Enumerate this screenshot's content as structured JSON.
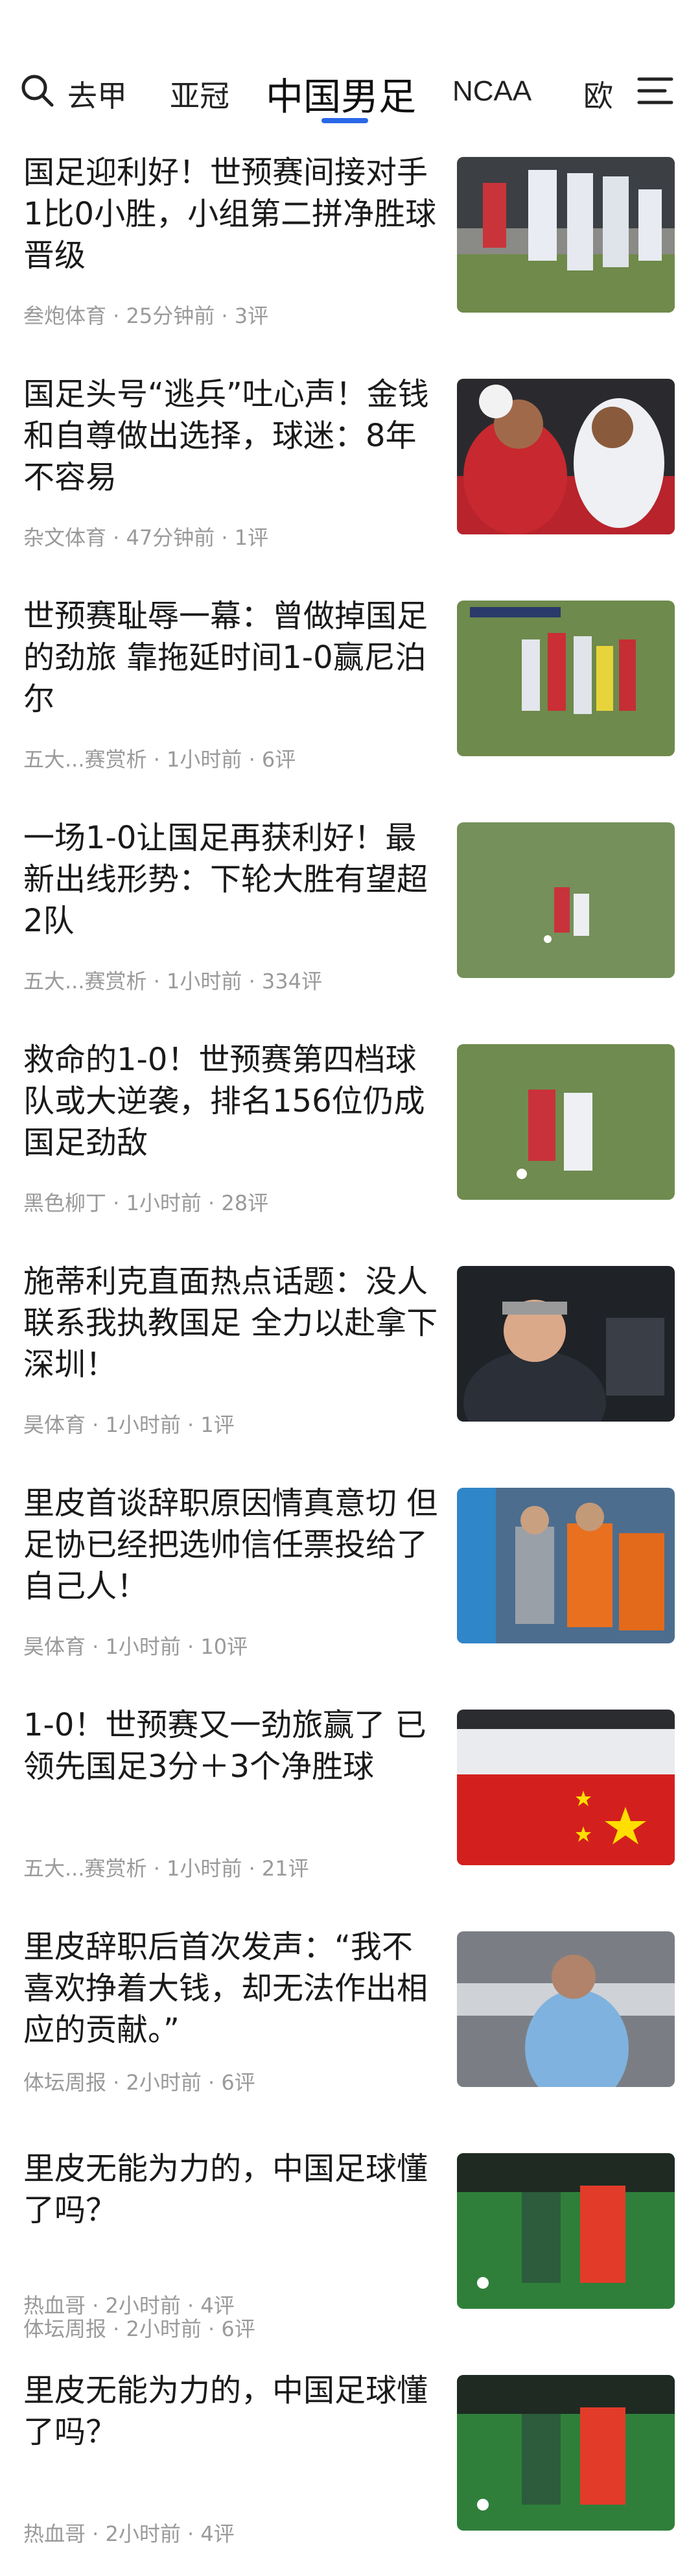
{
  "nav": {
    "tabs": [
      "去甲",
      "亚冠",
      "中国男足",
      "NCAA",
      "欧"
    ],
    "active_tab": "中国男足",
    "accent_color": "#2a67e8",
    "icons": [
      "search-icon",
      "menu-icon"
    ]
  },
  "feed": {
    "items": [
      {
        "title": "国足迎利好！世预赛间接对手1比0小胜，小组第二拼净胜球晋级",
        "meta": "叁炮体育 · 25分钟前 · 3评",
        "extra_meta": ""
      },
      {
        "title": "国足头号“逃兵”吐心声！金钱和自尊做出选择，球迷：8年不容易",
        "meta": "杂文体育 · 47分钟前 · 1评",
        "extra_meta": ""
      },
      {
        "title": "世预赛耻辱一幕：曾做掉国足的劲旅 靠拖延时间1-0赢尼泊尔",
        "meta": "五大...赛赏析 · 1小时前 · 6评",
        "extra_meta": ""
      },
      {
        "title": "一场1-0让国足再获利好！最新出线形势：下轮大胜有望超2队",
        "meta": "五大...赛赏析 · 1小时前 · 334评",
        "extra_meta": ""
      },
      {
        "title": "救命的1-0！世预赛第四档球队或大逆袭，排名156位仍成国足劲敌",
        "meta": "黑色柳丁 · 1小时前 · 28评",
        "extra_meta": ""
      },
      {
        "title": "施蒂利克直面热点话题：没人联系我执教国足 全力以赴拿下深圳！",
        "meta": "昊体育 · 1小时前 · 1评",
        "extra_meta": ""
      },
      {
        "title": "里皮首谈辞职原因情真意切 但足协已经把选帅信任票投给了自己人！",
        "meta": "昊体育 · 1小时前 · 10评",
        "extra_meta": ""
      },
      {
        "title": "1-0！世预赛又一劲旅赢了 已领先国足3分＋3个净胜球",
        "meta": "五大...赛赏析 · 1小时前 · 21评",
        "extra_meta": ""
      },
      {
        "title": "里皮辞职后首次发声：“我不喜欢挣着大钱，却无法作出相应的贡献。”",
        "meta": "体坛周报 · 2小时前 · 6评",
        "extra_meta": ""
      },
      {
        "title": "里皮无能为力的，中国足球懂了吗？",
        "meta": "热血哥 · 2小时前 · 4评",
        "extra_meta": "体坛周报 · 2小时前 · 6评"
      },
      {
        "title": "里皮无能为力的，中国足球懂了吗？",
        "meta": "热血哥 · 2小时前 · 4评",
        "extra_meta": ""
      }
    ]
  }
}
